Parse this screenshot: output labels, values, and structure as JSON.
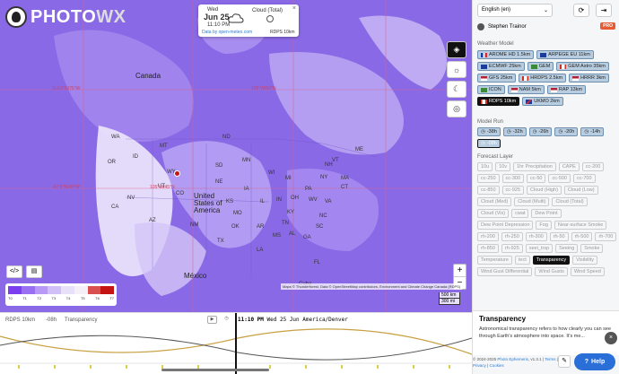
{
  "app": {
    "logo_main": "PHOTO",
    "logo_accent": "WX"
  },
  "weather_card": {
    "day": "Wed",
    "date": "Jun 25",
    "time": "11:10 PM",
    "layer_label": "Cloud (Total)",
    "source": "Data by open-meteo.com",
    "model": "RDPS 10km",
    "close": "×",
    "cloud_icon": "cloud-icon",
    "clock_icon": "clock-icon"
  },
  "map": {
    "country_labels": [
      "Canada",
      "United States of America",
      "México",
      "Cuba"
    ],
    "state_labels": [
      "WA",
      "OR",
      "ID",
      "MT",
      "ND",
      "MN",
      "WI",
      "MI",
      "NY",
      "VT",
      "ME",
      "NH",
      "MA",
      "CT",
      "PA",
      "OH",
      "IN",
      "IL",
      "IA",
      "NE",
      "SD",
      "WY",
      "NV",
      "CA",
      "UT",
      "CO",
      "KS",
      "MO",
      "KY",
      "VA",
      "WV",
      "NC",
      "TN",
      "AR",
      "OK",
      "NM",
      "AZ",
      "TX",
      "LA",
      "MS",
      "AL",
      "GA",
      "SC",
      "FL",
      "DE",
      "NJ",
      "MD"
    ],
    "coord_labels": [
      "114.5°N/75°W",
      "105°W/60°N",
      "-67.5°N/45°W",
      "45°N/117.5°W",
      "105°W/45°N",
      "-45°N/75°W",
      "-35°N/30°W"
    ],
    "attribution": "Maps © Thunderforest, Data © OpenStreetMap contributors, Environment and Climate Change Canada (RDPS)",
    "scale": [
      "500 km",
      "300 mi"
    ],
    "zoom_in": "+",
    "zoom_out": "−",
    "buttons": [
      "layers-icon",
      "sun-icon",
      "moon-icon",
      "target-icon"
    ],
    "tools": [
      "code-icon",
      "document-icon"
    ]
  },
  "legend": {
    "ticks": [
      "T0",
      "T1",
      "T2",
      "T3",
      "T4",
      "T5",
      "T6",
      "T7"
    ],
    "colors": [
      "#7b3ff0",
      "#9a6ff2",
      "#b69af5",
      "#d0c0f7",
      "#e8dff9",
      "#f5f0f5",
      "#d95050",
      "#c41414"
    ]
  },
  "timeline": {
    "model": "RDPS 10km",
    "offset": "-08h",
    "layer": "Transparency",
    "play": "▶",
    "clock": "◷",
    "time_bold": "11:10 PM",
    "time_rest": "Wed 25 Jun America/Denver"
  },
  "panel": {
    "language": "English (en)",
    "user": "Stephen Trainor",
    "pro": "PRO",
    "weather_model_title": "Weather Model",
    "models": [
      {
        "label": "AROME HD 1.5km",
        "flag": "fr"
      },
      {
        "label": "ARPEGE EU 11km",
        "flag": "eu"
      },
      {
        "label": "ECMWF 25km",
        "flag": "eu"
      },
      {
        "label": "GEM",
        "flag": "ca-leaf"
      },
      {
        "label": "GEM Astro 35km",
        "flag": "ca"
      },
      {
        "label": "GFS 25km",
        "flag": "us"
      },
      {
        "label": "HRDPS 2.5km",
        "flag": "ca"
      },
      {
        "label": "HRRR 3km",
        "flag": "us"
      },
      {
        "label": "ICON",
        "flag": "de-leaf"
      },
      {
        "label": "NAM 5km",
        "flag": "us"
      },
      {
        "label": "RAP 13km",
        "flag": "us"
      },
      {
        "label": "RDPS 10km",
        "flag": "ca",
        "active": true
      },
      {
        "label": "UKMO 2km",
        "flag": "uk"
      }
    ],
    "model_run_title": "Model Run",
    "runs": [
      {
        "label": "-38h"
      },
      {
        "label": "-32h"
      },
      {
        "label": "-26h"
      },
      {
        "label": "-20h"
      },
      {
        "label": "-14h"
      },
      {
        "label": "-08h",
        "active": true
      }
    ],
    "forecast_layer_title": "Forecast Layer",
    "layers": [
      {
        "label": "10u"
      },
      {
        "label": "10v"
      },
      {
        "label": "1hr Precipitation"
      },
      {
        "label": "CAPE"
      },
      {
        "label": "cc-200"
      },
      {
        "label": "cc-250"
      },
      {
        "label": "cc-300"
      },
      {
        "label": "cc-50"
      },
      {
        "label": "cc-500"
      },
      {
        "label": "cc-700"
      },
      {
        "label": "cc-850"
      },
      {
        "label": "cc-925"
      },
      {
        "label": "Cloud (High)"
      },
      {
        "label": "Cloud (Low)"
      },
      {
        "label": "Cloud (Med)"
      },
      {
        "label": "Cloud (Multi)"
      },
      {
        "label": "Cloud (Total)"
      },
      {
        "label": "Cloud (Vis)"
      },
      {
        "label": "cwat"
      },
      {
        "label": "Dew Point"
      },
      {
        "label": "Dew Point Depression"
      },
      {
        "label": "Fog"
      },
      {
        "label": "Near-surface Smoke"
      },
      {
        "label": "rh-200"
      },
      {
        "label": "rh-250"
      },
      {
        "label": "rh-300"
      },
      {
        "label": "rh-50"
      },
      {
        "label": "rh-500"
      },
      {
        "label": "rh-700"
      },
      {
        "label": "rh-850"
      },
      {
        "label": "rh-925"
      },
      {
        "label": "seei_trsp"
      },
      {
        "label": "Seeing"
      },
      {
        "label": "Smoke"
      },
      {
        "label": "Temperature"
      },
      {
        "label": "tect"
      },
      {
        "label": "Transparency",
        "active": true
      },
      {
        "label": "Visibility"
      },
      {
        "label": "Wind Gust Differential"
      },
      {
        "label": "Wind Gusts"
      },
      {
        "label": "Wind Speed"
      }
    ],
    "info_title": "Transparency",
    "info_text": "Astronomical transparency refers to how clearly you can see through Earth's atmosphere into space. It's me...",
    "footer_copy": "© 2024-2025",
    "footer_link": "Photo Ephemeris",
    "footer_version": ", v1.3.1 | ",
    "footer_terms": "Terms",
    "footer_privacy": "Privacy",
    "footer_cookies": "Cookies",
    "help": "Help",
    "close": "×"
  }
}
